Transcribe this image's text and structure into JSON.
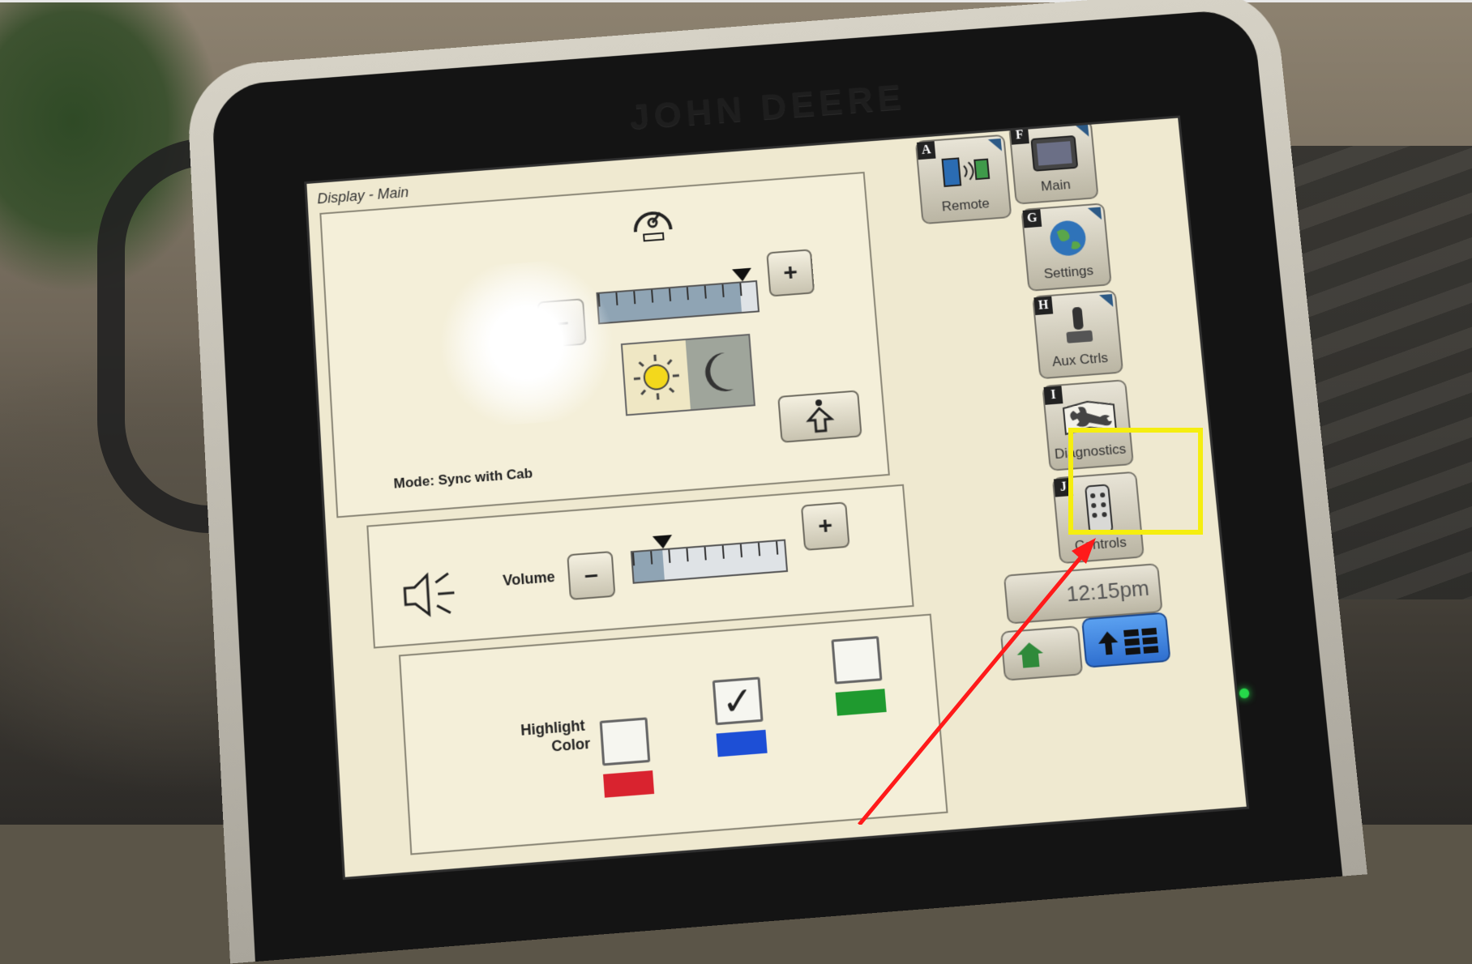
{
  "device": {
    "brand": "JOHN DEERE",
    "screen_title": "Display - Main"
  },
  "brightness": {
    "minus": "–",
    "plus": "+",
    "level": 0.9,
    "mode_label": "Mode: Sync with Cab"
  },
  "volume": {
    "label": "Volume",
    "minus": "–",
    "plus": "+",
    "level": 0.2
  },
  "highlight": {
    "label_line1": "Highlight",
    "label_line2": "Color",
    "options": [
      {
        "color": "#d9232f",
        "selected": false
      },
      {
        "color": "#1d4fd6",
        "selected": true
      },
      {
        "color": "#1f9a2f",
        "selected": false
      }
    ],
    "check_mark": "✓"
  },
  "side_tiles": [
    {
      "letter": "A",
      "label": "Remote"
    },
    {
      "letter": "F",
      "label": "Main"
    },
    {
      "letter": "G",
      "label": "Settings"
    },
    {
      "letter": "H",
      "label": "Aux Ctrls"
    },
    {
      "letter": "I",
      "label": "Diagnostics"
    },
    {
      "letter": "J",
      "label": "Controls"
    }
  ],
  "status": {
    "time": "12:15pm"
  },
  "annotation": {
    "highlight_color": "#f5ee0f",
    "arrow_color": "#ff1a1a"
  }
}
